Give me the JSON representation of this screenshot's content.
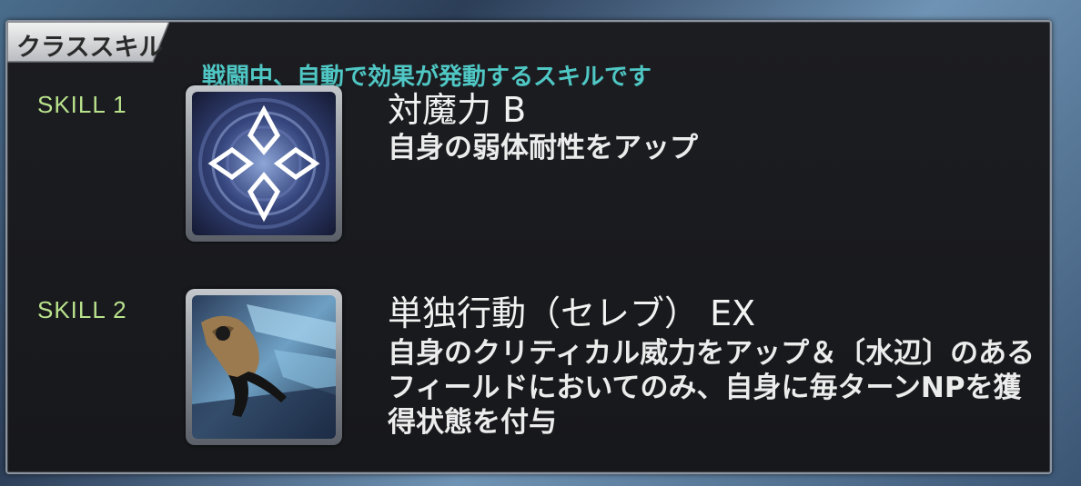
{
  "section": {
    "tab_label": "クラススキル",
    "subtitle": "戦闘中、自動で効果が発動するスキルです"
  },
  "skills": [
    {
      "label": "SKILL 1",
      "name": "対魔力 B",
      "description": "自身の弱体耐性をアップ",
      "icon": "magic-resistance-icon"
    },
    {
      "label": "SKILL 2",
      "name": "単独行動（セレブ） EX",
      "description": "自身のクリティカル威力をアップ＆〔水辺〕のあるフィールドにおいてのみ、自身に毎ターンNPを獲得状態を付与",
      "icon": "independent-action-icon"
    }
  ],
  "colors": {
    "subtitle": "#4fc7c4",
    "skill_label": "#b9e28c",
    "text": "#ececec"
  }
}
